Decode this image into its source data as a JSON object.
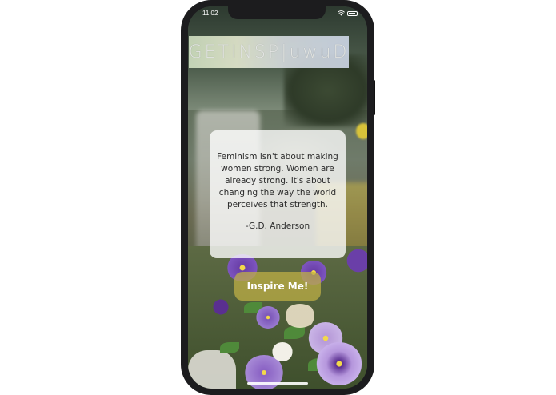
{
  "status_bar": {
    "time": "11:02"
  },
  "app": {
    "title": "GETINSP|uwuD"
  },
  "quote": {
    "text": "Feminism isn't about making women strong. Women are already strong. It's about changing the way the world perceives that strength.",
    "author": "-G.D. Anderson"
  },
  "actions": {
    "inspire_label": "Inspire Me!"
  },
  "icons": {
    "wifi": "wifi-icon",
    "battery": "battery-icon"
  },
  "colors": {
    "card_background": "#ffffffc7",
    "button_background": "#beaf46",
    "quote_text": "#2b2b2b",
    "phone_frame": "#1c1c1e"
  }
}
